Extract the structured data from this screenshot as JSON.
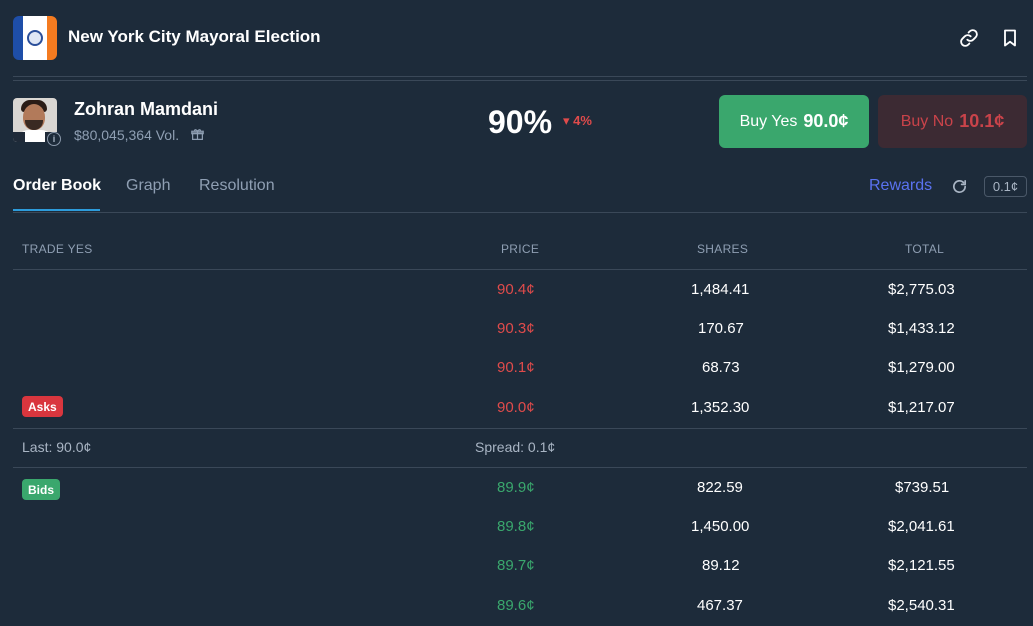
{
  "market": {
    "title": "New York City Mayoral Election"
  },
  "outcome": {
    "name": "Zohran Mamdani",
    "volume": "$80,045,364 Vol.",
    "probability": "90%",
    "change": "▾ 4%",
    "buy_yes_label": "Buy Yes",
    "buy_yes_price": "90.0¢",
    "buy_no_label": "Buy No",
    "buy_no_price": "10.1¢"
  },
  "tabs": [
    {
      "label": "Order Book",
      "active": true
    },
    {
      "label": "Graph",
      "active": false
    },
    {
      "label": "Resolution",
      "active": false
    }
  ],
  "toolbar": {
    "rewards_label": "Rewards",
    "tick_size": "0.1¢"
  },
  "orderbook": {
    "headers": {
      "trade": "TRADE YES",
      "price": "PRICE",
      "shares": "SHARES",
      "total": "TOTAL"
    },
    "asks_label": "Asks",
    "bids_label": "Bids",
    "asks": [
      {
        "price": "90.4¢",
        "shares": "1,484.41",
        "total": "$2,775.03"
      },
      {
        "price": "90.3¢",
        "shares": "170.67",
        "total": "$1,433.12"
      },
      {
        "price": "90.1¢",
        "shares": "68.73",
        "total": "$1,279.00"
      },
      {
        "price": "90.0¢",
        "shares": "1,352.30",
        "total": "$1,217.07"
      }
    ],
    "last": "Last: 90.0¢",
    "spread": "Spread: 0.1¢",
    "bids": [
      {
        "price": "89.9¢",
        "shares": "822.59",
        "total": "$739.51"
      },
      {
        "price": "89.8¢",
        "shares": "1,450.00",
        "total": "$2,041.61"
      },
      {
        "price": "89.7¢",
        "shares": "89.12",
        "total": "$2,121.55"
      },
      {
        "price": "89.6¢",
        "shares": "467.37",
        "total": "$2,540.31"
      }
    ]
  },
  "colors": {
    "background": "#1d2b3a",
    "ask": "#e04b4b",
    "bid": "#3aa76d",
    "accent": "#2d9cdb"
  },
  "icons": [
    "flag-icon",
    "link-icon",
    "bookmark-icon",
    "info-icon",
    "gift-icon",
    "refresh-icon"
  ]
}
